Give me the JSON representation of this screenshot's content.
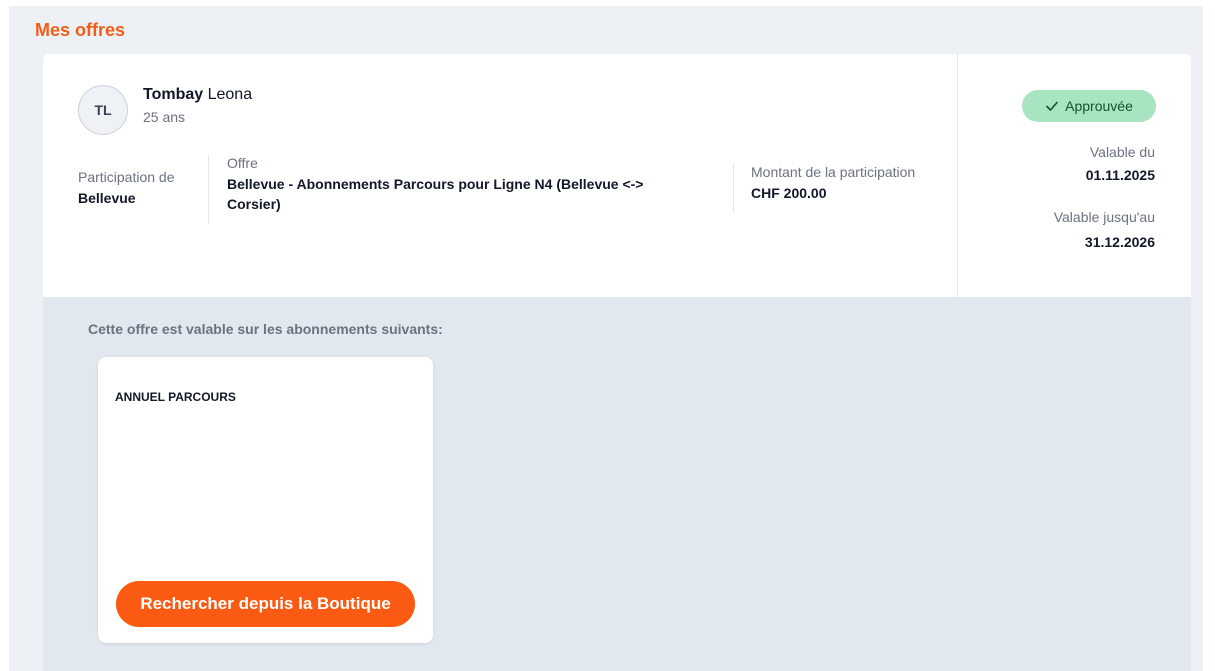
{
  "section": {
    "title": "Mes offres"
  },
  "person": {
    "initials": "TL",
    "last_name": "Tombay",
    "first_name": "Leona",
    "age": "25 ans"
  },
  "offer": {
    "participation_label": "Participation de",
    "participation_value": "Bellevue",
    "offer_label": "Offre",
    "offer_value": "Bellevue - Abonnements Parcours pour Ligne N4 (Bellevue <-> Corsier)",
    "amount_label": "Montant de la participation",
    "amount_value": "CHF 200.00"
  },
  "status": {
    "badge_label": "Approuvée",
    "badge_icon": "check-icon",
    "badge_color": "#a7e4bf",
    "valid_from_label": "Valable du",
    "valid_from": "01.11.2025",
    "valid_until_label": "Valable jusqu'au",
    "valid_until": "31.12.2026"
  },
  "subscriptions": {
    "caption": "Cette offre est valable sur les abonnements suivants:",
    "items": [
      {
        "title": "ANNUEL PARCOURS",
        "button_label": "Rechercher depuis la Boutique"
      }
    ]
  },
  "colors": {
    "accent": "#f35e16",
    "button": "#fb5a12"
  }
}
